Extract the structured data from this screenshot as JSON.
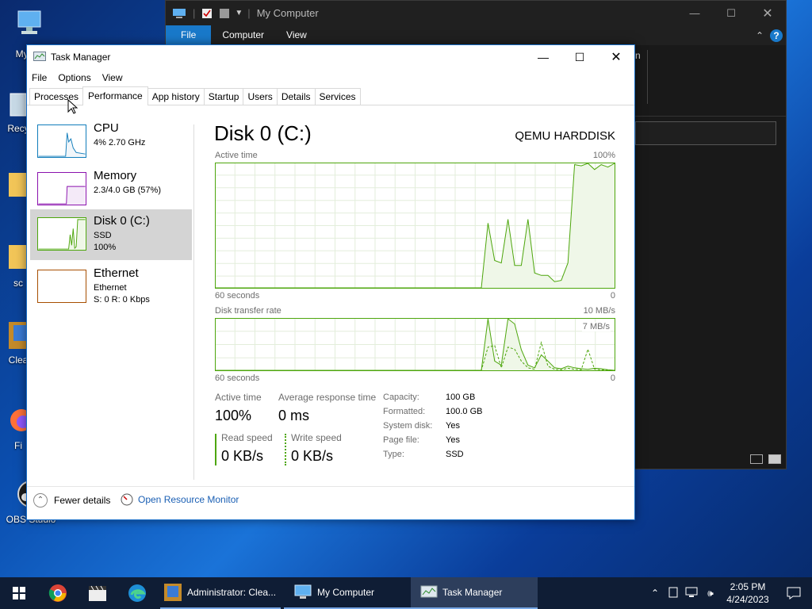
{
  "desktop": {
    "icons": [
      {
        "label": "My Co",
        "icon": "computer-icon"
      },
      {
        "label": "Recy",
        "icon": "recycle-bin-icon"
      },
      {
        "label": "",
        "icon": "folder-icon"
      },
      {
        "label": "sc",
        "icon": "folder-icon"
      },
      {
        "label": "Clea",
        "icon": "app-icon"
      },
      {
        "label": "Fi",
        "icon": "firefox-icon"
      },
      {
        "label": "OBS Studio",
        "icon": "obs-icon"
      }
    ]
  },
  "explorer": {
    "title": "My Computer",
    "ribbon_tabs": [
      "File",
      "Computer",
      "View"
    ],
    "partial_text": "n"
  },
  "taskmanager": {
    "title": "Task Manager",
    "menu": [
      "File",
      "Options",
      "View"
    ],
    "tabs": [
      "Processes",
      "Performance",
      "App history",
      "Startup",
      "Users",
      "Details",
      "Services"
    ],
    "active_tab": "Performance",
    "sidebar": [
      {
        "name": "CPU",
        "sub1": "4%  2.70 GHz",
        "sub2": "",
        "color": "#117dbb"
      },
      {
        "name": "Memory",
        "sub1": "2.3/4.0 GB (57%)",
        "sub2": "",
        "color": "#8b12ae"
      },
      {
        "name": "Disk 0 (C:)",
        "sub1": "SSD",
        "sub2": "100%",
        "color": "#4da60c"
      },
      {
        "name": "Ethernet",
        "sub1": "Ethernet",
        "sub2": "S: 0  R: 0 Kbps",
        "color": "#a74f01"
      }
    ],
    "detail": {
      "title": "Disk 0 (C:)",
      "model": "QEMU HARDDISK",
      "graph1": {
        "label": "Active time",
        "max": "100%",
        "time": "60 seconds",
        "min": "0"
      },
      "graph2": {
        "label": "Disk transfer rate",
        "max": "10 MB/s",
        "inner": "7 MB/s",
        "time": "60 seconds",
        "min": "0"
      },
      "stats": {
        "active_time_label": "Active time",
        "active_time": "100%",
        "avg_resp_label": "Average response time",
        "avg_resp": "0 ms",
        "read_label": "Read speed",
        "read": "0 KB/s",
        "write_label": "Write speed",
        "write": "0 KB/s"
      },
      "props": [
        {
          "k": "Capacity:",
          "v": "100 GB"
        },
        {
          "k": "Formatted:",
          "v": "100.0 GB"
        },
        {
          "k": "System disk:",
          "v": "Yes"
        },
        {
          "k": "Page file:",
          "v": "Yes"
        },
        {
          "k": "Type:",
          "v": "SSD"
        }
      ]
    },
    "footer": {
      "fewer": "Fewer details",
      "monitor": "Open Resource Monitor"
    },
    "active_time_series": [
      0,
      0,
      0,
      0,
      0,
      0,
      0,
      0,
      0,
      0,
      0,
      0,
      0,
      0,
      0,
      0,
      0,
      0,
      0,
      0,
      0,
      0,
      0,
      0,
      0,
      0,
      0,
      0,
      0,
      0,
      0,
      0,
      0,
      0,
      0,
      0,
      0,
      0,
      0,
      0,
      0,
      52,
      22,
      20,
      55,
      18,
      18,
      55,
      12,
      10,
      10,
      5,
      6,
      20,
      99,
      98,
      100,
      95,
      99,
      97,
      100
    ],
    "transfer_series": [
      0,
      0,
      0,
      0,
      0,
      0,
      0,
      0,
      0,
      0,
      0,
      0,
      0,
      0,
      0,
      0,
      0,
      0,
      0,
      0,
      0,
      0,
      0,
      0,
      0,
      0,
      0,
      0,
      0,
      0,
      0,
      0,
      0,
      0,
      0,
      0,
      0,
      0,
      0,
      0,
      0,
      100,
      18,
      10,
      100,
      90,
      40,
      10,
      5,
      30,
      18,
      5,
      3,
      8,
      5,
      3,
      2,
      4,
      3,
      1,
      0
    ]
  },
  "taskbar": {
    "items": [
      {
        "label": "Administrator: Clea...",
        "icon": "app-icon"
      },
      {
        "label": "My Computer",
        "icon": "computer-icon"
      },
      {
        "label": "Task Manager",
        "icon": "task-manager-icon"
      }
    ],
    "time": "2:05 PM",
    "date": "4/24/2023"
  }
}
